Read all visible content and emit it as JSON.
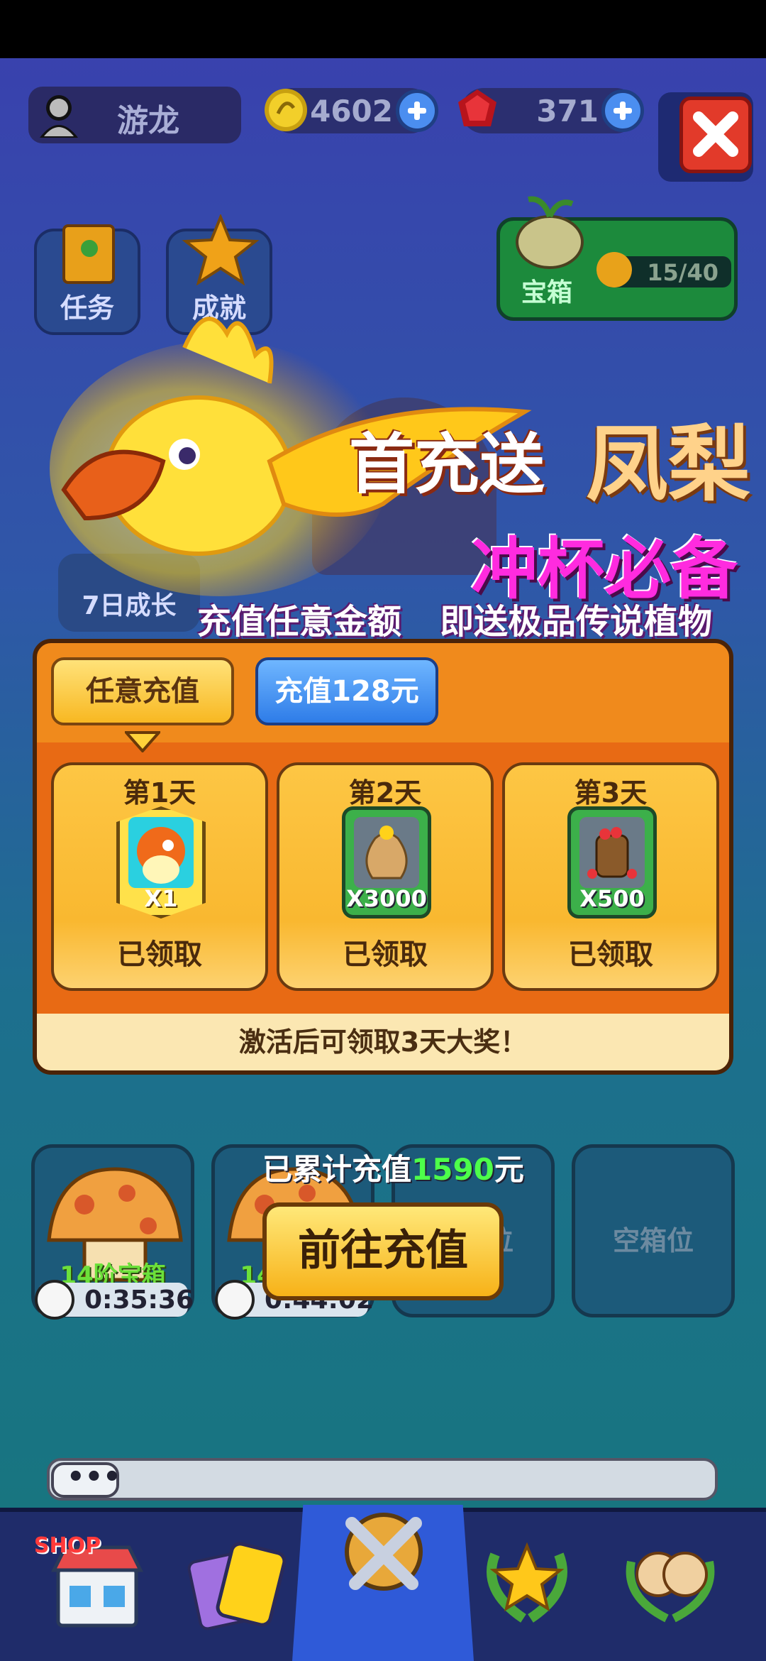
{
  "player": {
    "name": "游龙"
  },
  "resources": {
    "coins": "4602",
    "gems": "371"
  },
  "quick_buttons": {
    "tasks": "任务",
    "achievements": "成就",
    "growth": "7日成长"
  },
  "chest": {
    "label": "宝箱",
    "progress": "15/40"
  },
  "promo": {
    "title_part1": "首充送",
    "title_part2": "凤梨",
    "slogan": "冲杯必备",
    "subtitle_a": "充值任意金额",
    "subtitle_b": "即送极品传说植物"
  },
  "tabs": {
    "any_recharge": "任意充值",
    "recharge_128": "充值128元"
  },
  "days": [
    {
      "title": "第1天",
      "qty": "X1",
      "status": "已领取"
    },
    {
      "title": "第2天",
      "qty": "X3000",
      "status": "已领取"
    },
    {
      "title": "第3天",
      "qty": "X500",
      "status": "已领取"
    }
  ],
  "panel_footer": "激活后可领取3天大奖！",
  "slots": {
    "mushroom_label": "14阶宝箱",
    "timer1": "0:35:36",
    "timer2": "0:44:02",
    "empty_label": "空箱位"
  },
  "recharge": {
    "total_prefix": "已累计充值",
    "total_amount": "1590",
    "total_suffix": "元",
    "go_button": "前往充值"
  },
  "chat": {
    "placeholder": "•••"
  },
  "nav": {
    "shop": "SHOP"
  },
  "colors": {
    "accent_orange": "#f08a1c",
    "accent_blue": "#2e7ce8",
    "slogan_pink": "#ff2bdf",
    "amount_green": "#4dff4a"
  }
}
